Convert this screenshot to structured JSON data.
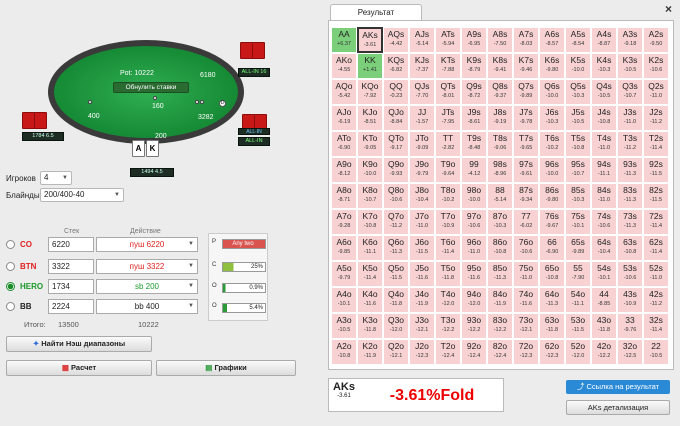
{
  "table": {
    "pot_label": "Pot: 10222",
    "reset_label": "Обнулить ставки",
    "seats": [
      {
        "name": "BTN",
        "stack": "6180",
        "info": "ALL-IN 16",
        "bet": ""
      },
      {
        "name": "CO",
        "stack": "",
        "info": "ALL-IN",
        "bet": ""
      },
      {
        "name": "BB",
        "stack": "",
        "info": "1784 6.5",
        "bet": "400"
      },
      {
        "name": "HERO",
        "stack": "",
        "info": "1494 4.5",
        "bet": "200"
      }
    ],
    "bets": {
      "left": "400",
      "center": "160",
      "right": "3282",
      "hero": "200"
    },
    "hero_cards": [
      "A",
      "K"
    ]
  },
  "settings": {
    "players_label": "Игроков",
    "players_value": "4",
    "blinds_label": "Блайнды",
    "blinds_value": "200/400-40"
  },
  "columns": {
    "stack": "Стек",
    "action": "Действие"
  },
  "players": [
    {
      "name": "CO",
      "stack": "6220",
      "action": "пуш 6220",
      "action_color": "#e02020",
      "selected": false
    },
    {
      "name": "BTN",
      "stack": "3322",
      "action": "пуш 3322",
      "action_color": "#e02020",
      "selected": false
    },
    {
      "name": "HERO",
      "stack": "1734",
      "action": "sb 200",
      "action_color": "#1a9a2a",
      "selected": true
    },
    {
      "name": "BB",
      "stack": "2224",
      "action": "bb 400",
      "action_color": "#222222",
      "selected": false
    }
  ],
  "totals": {
    "label": "Итого:",
    "stack": "13500",
    "action": "10222"
  },
  "legend": [
    {
      "letter": "P",
      "value": "Any two",
      "color": "#d9534f",
      "fill": 1.0
    },
    {
      "letter": "C",
      "value": "25%",
      "color": "#8fbf3f",
      "fill": 0.25
    },
    {
      "letter": "O",
      "value": "0.9%",
      "color": "#2a9a3a",
      "fill": 0.009
    },
    {
      "letter": "O",
      "value": "5.4%",
      "color": "#2a9a3a",
      "fill": 0.054
    }
  ],
  "buttons": {
    "nash": "Найти Нэш диапазоны",
    "calc": "Расчет",
    "charts": "Графики"
  },
  "result": {
    "tab_label": "Результат",
    "close": "×",
    "selected_hand": "AKs",
    "selected_value": "-3.61",
    "selected_result": "-3.61%Fold",
    "link_label": "Ссылка на результат",
    "detail_label": "AKs детализация",
    "grid": [
      [
        [
          "AA",
          "+6.37"
        ],
        [
          "AKs",
          "-3.61"
        ],
        [
          "AQs",
          "-4.42"
        ],
        [
          "AJs",
          "-5.14"
        ],
        [
          "ATs",
          "-5.94"
        ],
        [
          "A9s",
          "-6.95"
        ],
        [
          "A8s",
          "-7.50"
        ],
        [
          "A7s",
          "-8.03"
        ],
        [
          "A6s",
          "-8.57"
        ],
        [
          "A5s",
          "-8.54"
        ],
        [
          "A4s",
          "-8.87"
        ],
        [
          "A3s",
          "-9.18"
        ],
        [
          "A2s",
          "-9.50"
        ]
      ],
      [
        [
          "AKo",
          "-4.55"
        ],
        [
          "KK",
          "+1.41"
        ],
        [
          "KQs",
          "-6.82"
        ],
        [
          "KJs",
          "-7.37"
        ],
        [
          "KTs",
          "-7.88"
        ],
        [
          "K9s",
          "-8.79"
        ],
        [
          "K8s",
          "-9.41"
        ],
        [
          "K7s",
          "-9.46"
        ],
        [
          "K6s",
          "-9.80"
        ],
        [
          "K5s",
          "-10.0"
        ],
        [
          "K4s",
          "-10.3"
        ],
        [
          "K3s",
          "-10.5"
        ],
        [
          "K2s",
          "-10.6"
        ]
      ],
      [
        [
          "AQo",
          "-5.42"
        ],
        [
          "KQo",
          "-7.92"
        ],
        [
          "QQ",
          "-0.23"
        ],
        [
          "QJs",
          "-7.70"
        ],
        [
          "QTs",
          "-8.01"
        ],
        [
          "Q9s",
          "-8.72"
        ],
        [
          "Q8s",
          "-9.37"
        ],
        [
          "Q7s",
          "-9.89"
        ],
        [
          "Q6s",
          "-10.0"
        ],
        [
          "Q5s",
          "-10.3"
        ],
        [
          "Q4s",
          "-10.5"
        ],
        [
          "Q3s",
          "-10.7"
        ],
        [
          "Q2s",
          "-11.0"
        ]
      ],
      [
        [
          "AJo",
          "-6.19"
        ],
        [
          "KJo",
          "-8.51"
        ],
        [
          "QJo",
          "-8.84"
        ],
        [
          "JJ",
          "-1.57"
        ],
        [
          "JTs",
          "-7.95"
        ],
        [
          "J9s",
          "-8.61"
        ],
        [
          "J8s",
          "-9.19"
        ],
        [
          "J7s",
          "-9.78"
        ],
        [
          "J6s",
          "-10.3"
        ],
        [
          "J5s",
          "-10.5"
        ],
        [
          "J4s",
          "-10.8"
        ],
        [
          "J3s",
          "-11.0"
        ],
        [
          "J2s",
          "-11.2"
        ]
      ],
      [
        [
          "ATo",
          "-6.90"
        ],
        [
          "KTo",
          "-9.05"
        ],
        [
          "QTo",
          "-9.17"
        ],
        [
          "JTo",
          "-9.09"
        ],
        [
          "TT",
          "-2.82"
        ],
        [
          "T9s",
          "-8.48"
        ],
        [
          "T8s",
          "-9.06"
        ],
        [
          "T7s",
          "-9.65"
        ],
        [
          "T6s",
          "-10.2"
        ],
        [
          "T5s",
          "-10.8"
        ],
        [
          "T4s",
          "-11.0"
        ],
        [
          "T3s",
          "-11.2"
        ],
        [
          "T2s",
          "-11.4"
        ]
      ],
      [
        [
          "A9o",
          "-8.12"
        ],
        [
          "K9o",
          "-10.0"
        ],
        [
          "Q9o",
          "-9.93"
        ],
        [
          "J9o",
          "-9.79"
        ],
        [
          "T9o",
          "-9.64"
        ],
        [
          "99",
          "-4.12"
        ],
        [
          "98s",
          "-8.96"
        ],
        [
          "97s",
          "-9.61"
        ],
        [
          "96s",
          "-10.0"
        ],
        [
          "95s",
          "-10.7"
        ],
        [
          "94s",
          "-11.1"
        ],
        [
          "93s",
          "-11.3"
        ],
        [
          "92s",
          "-11.5"
        ]
      ],
      [
        [
          "A8o",
          "-8.71"
        ],
        [
          "K8o",
          "-10.7"
        ],
        [
          "Q8o",
          "-10.6"
        ],
        [
          "J8o",
          "-10.4"
        ],
        [
          "T8o",
          "-10.2"
        ],
        [
          "98o",
          "-10.0"
        ],
        [
          "88",
          "-5.14"
        ],
        [
          "87s",
          "-9.34"
        ],
        [
          "86s",
          "-9.80"
        ],
        [
          "85s",
          "-10.3"
        ],
        [
          "84s",
          "-11.0"
        ],
        [
          "83s",
          "-11.3"
        ],
        [
          "82s",
          "-11.5"
        ]
      ],
      [
        [
          "A7o",
          "-9.28"
        ],
        [
          "K7o",
          "-10.8"
        ],
        [
          "Q7o",
          "-11.2"
        ],
        [
          "J7o",
          "-11.0"
        ],
        [
          "T7o",
          "-10.9"
        ],
        [
          "97o",
          "-10.6"
        ],
        [
          "87o",
          "-10.3"
        ],
        [
          "77",
          "-6.02"
        ],
        [
          "76s",
          "-9.67"
        ],
        [
          "75s",
          "-10.1"
        ],
        [
          "74s",
          "-10.6"
        ],
        [
          "73s",
          "-11.3"
        ],
        [
          "72s",
          "-11.4"
        ]
      ],
      [
        [
          "A6o",
          "-9.85"
        ],
        [
          "K6o",
          "-11.1"
        ],
        [
          "Q6o",
          "-11.3"
        ],
        [
          "J6o",
          "-11.5"
        ],
        [
          "T6o",
          "-11.4"
        ],
        [
          "96o",
          "-11.0"
        ],
        [
          "86o",
          "-10.8"
        ],
        [
          "76o",
          "-10.6"
        ],
        [
          "66",
          "-6.90"
        ],
        [
          "65s",
          "-9.89"
        ],
        [
          "64s",
          "-10.4"
        ],
        [
          "63s",
          "-10.8"
        ],
        [
          "62s",
          "-11.4"
        ]
      ],
      [
        [
          "A5o",
          "-9.79"
        ],
        [
          "K5o",
          "-11.4"
        ],
        [
          "Q5o",
          "-11.5"
        ],
        [
          "J5o",
          "-11.6"
        ],
        [
          "T5o",
          "-11.8"
        ],
        [
          "95o",
          "-11.6"
        ],
        [
          "85o",
          "-11.3"
        ],
        [
          "75o",
          "-11.0"
        ],
        [
          "65o",
          "-10.8"
        ],
        [
          "55",
          "-7.90"
        ],
        [
          "54s",
          "-10.1"
        ],
        [
          "53s",
          "-10.6"
        ],
        [
          "52s",
          "-11.0"
        ]
      ],
      [
        [
          "A4o",
          "-10.1"
        ],
        [
          "K4o",
          "-11.6"
        ],
        [
          "Q4o",
          "-11.8"
        ],
        [
          "J4o",
          "-11.9"
        ],
        [
          "T4o",
          "-12.0"
        ],
        [
          "94o",
          "-12.0"
        ],
        [
          "84o",
          "-11.9"
        ],
        [
          "74o",
          "-11.6"
        ],
        [
          "64o",
          "-11.3"
        ],
        [
          "54o",
          "-11.1"
        ],
        [
          "44",
          "-8.85"
        ],
        [
          "43s",
          "-10.9"
        ],
        [
          "42s",
          "-11.2"
        ]
      ],
      [
        [
          "A3o",
          "-10.5"
        ],
        [
          "K3o",
          "-11.8"
        ],
        [
          "Q3o",
          "-12.0"
        ],
        [
          "J3o",
          "-12.1"
        ],
        [
          "T3o",
          "-12.2"
        ],
        [
          "93o",
          "-12.2"
        ],
        [
          "83o",
          "-12.2"
        ],
        [
          "73o",
          "-12.1"
        ],
        [
          "63o",
          "-11.8"
        ],
        [
          "53o",
          "-11.5"
        ],
        [
          "43o",
          "-11.8"
        ],
        [
          "33",
          "-9.76"
        ],
        [
          "32s",
          "-11.4"
        ]
      ],
      [
        [
          "A2o",
          "-10.8"
        ],
        [
          "K2o",
          "-11.9"
        ],
        [
          "Q2o",
          "-12.1"
        ],
        [
          "J2o",
          "-12.3"
        ],
        [
          "T2o",
          "-12.4"
        ],
        [
          "92o",
          "-12.4"
        ],
        [
          "82o",
          "-12.4"
        ],
        [
          "72o",
          "-12.3"
        ],
        [
          "62o",
          "-12.3"
        ],
        [
          "52o",
          "-12.0"
        ],
        [
          "42o",
          "-12.2"
        ],
        [
          "32o",
          "-12.5"
        ],
        [
          "22",
          "-10.5"
        ]
      ]
    ]
  }
}
